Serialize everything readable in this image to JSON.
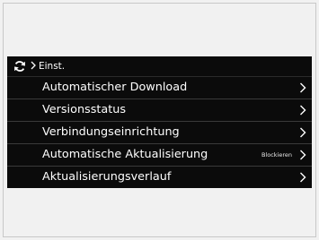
{
  "breadcrumb": {
    "label": "Einst."
  },
  "menu": {
    "items": [
      {
        "label": "Automatischer Download",
        "status": ""
      },
      {
        "label": "Versionsstatus",
        "status": ""
      },
      {
        "label": "Verbindungseinrichtung",
        "status": ""
      },
      {
        "label": "Automatische Aktualisierung",
        "status": "Blockieren"
      },
      {
        "label": "Aktualisierungsverlauf",
        "status": ""
      }
    ]
  },
  "icons": {
    "header": "refresh-icon",
    "separator": "chevron-right-icon",
    "row_arrow": "chevron-right-icon"
  },
  "colors": {
    "screen_background": "#0b0b0b",
    "text": "#ffffff",
    "divider": "#3a3a3a",
    "page_background": "#f1f1f1"
  }
}
